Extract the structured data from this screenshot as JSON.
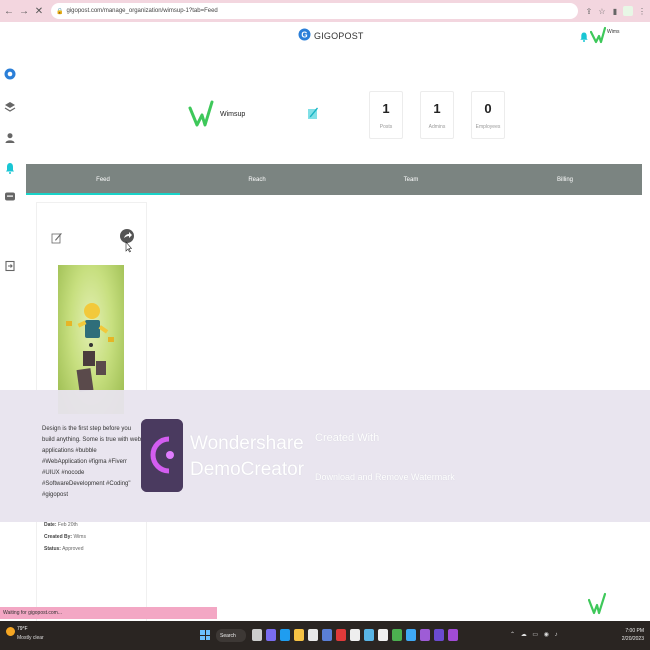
{
  "browser": {
    "url": "gigopost.com/manage_organization/wimsup-1?tab=Feed"
  },
  "header": {
    "brand": "GIGOPOST",
    "user_name": "Wims"
  },
  "org": {
    "name": "Wimsup",
    "stats": [
      {
        "value": "1",
        "label": "Posts"
      },
      {
        "value": "1",
        "label": "Admins"
      },
      {
        "value": "0",
        "label": "Employees"
      }
    ]
  },
  "tabs": [
    "Feed",
    "Reach",
    "Team",
    "Billing"
  ],
  "active_tab": "Feed",
  "post": {
    "text": "Design is the first step before you build anything. Some is true with web applications #bubble #WebApplication #figma #Fiverr #UIUX #nocode #SoftwareDevelopment #Coding\" #gigopost",
    "date_label": "Date:",
    "date_value": "Feb 20th",
    "created_by_label": "Created By:",
    "created_by_value": "Wims",
    "status_label": "Status:",
    "status_value": "Approved"
  },
  "overlay": {
    "brand_line1": "Wondershare",
    "brand_line2": "DemoCreator",
    "created_with": "Created With",
    "download": "Download and Remove Watermark"
  },
  "status_bar": "Waiting for gigopost.com...",
  "taskbar": {
    "temp": "79°F",
    "weather": "Mostly clear",
    "search": "Search",
    "time": "7:00 PM",
    "date": "2/20/2023"
  },
  "colors": {
    "tab_bg": "#7b8481",
    "active_tab_underline": "#19d2c8",
    "brand_green": "#3ec85a",
    "browser_bar": "#f3d6df"
  }
}
